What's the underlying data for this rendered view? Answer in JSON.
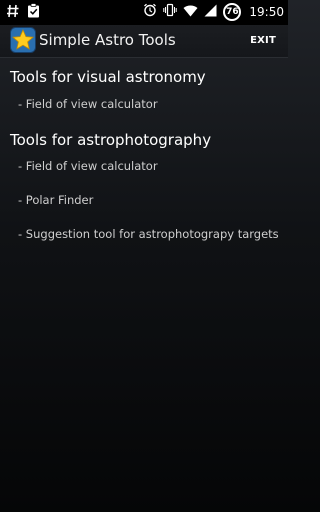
{
  "status_bar": {
    "left_icons": [
      "hash-icon",
      "clipboard-check-icon"
    ],
    "right_icons": [
      "alarm-icon",
      "vibrate-icon",
      "wifi-icon",
      "signal-icon"
    ],
    "battery_level": "76",
    "time": "19:50"
  },
  "action_bar": {
    "title": "Simple Astro Tools",
    "exit_label": "EXIT"
  },
  "sections": [
    {
      "title": "Tools for visual astronomy",
      "items": [
        "- Field of view calculator"
      ]
    },
    {
      "title": "Tools for astrophotography",
      "items": [
        "- Field of view calculator",
        "- Polar Finder",
        "- Suggestion tool for astrophotograpy targets"
      ]
    }
  ]
}
